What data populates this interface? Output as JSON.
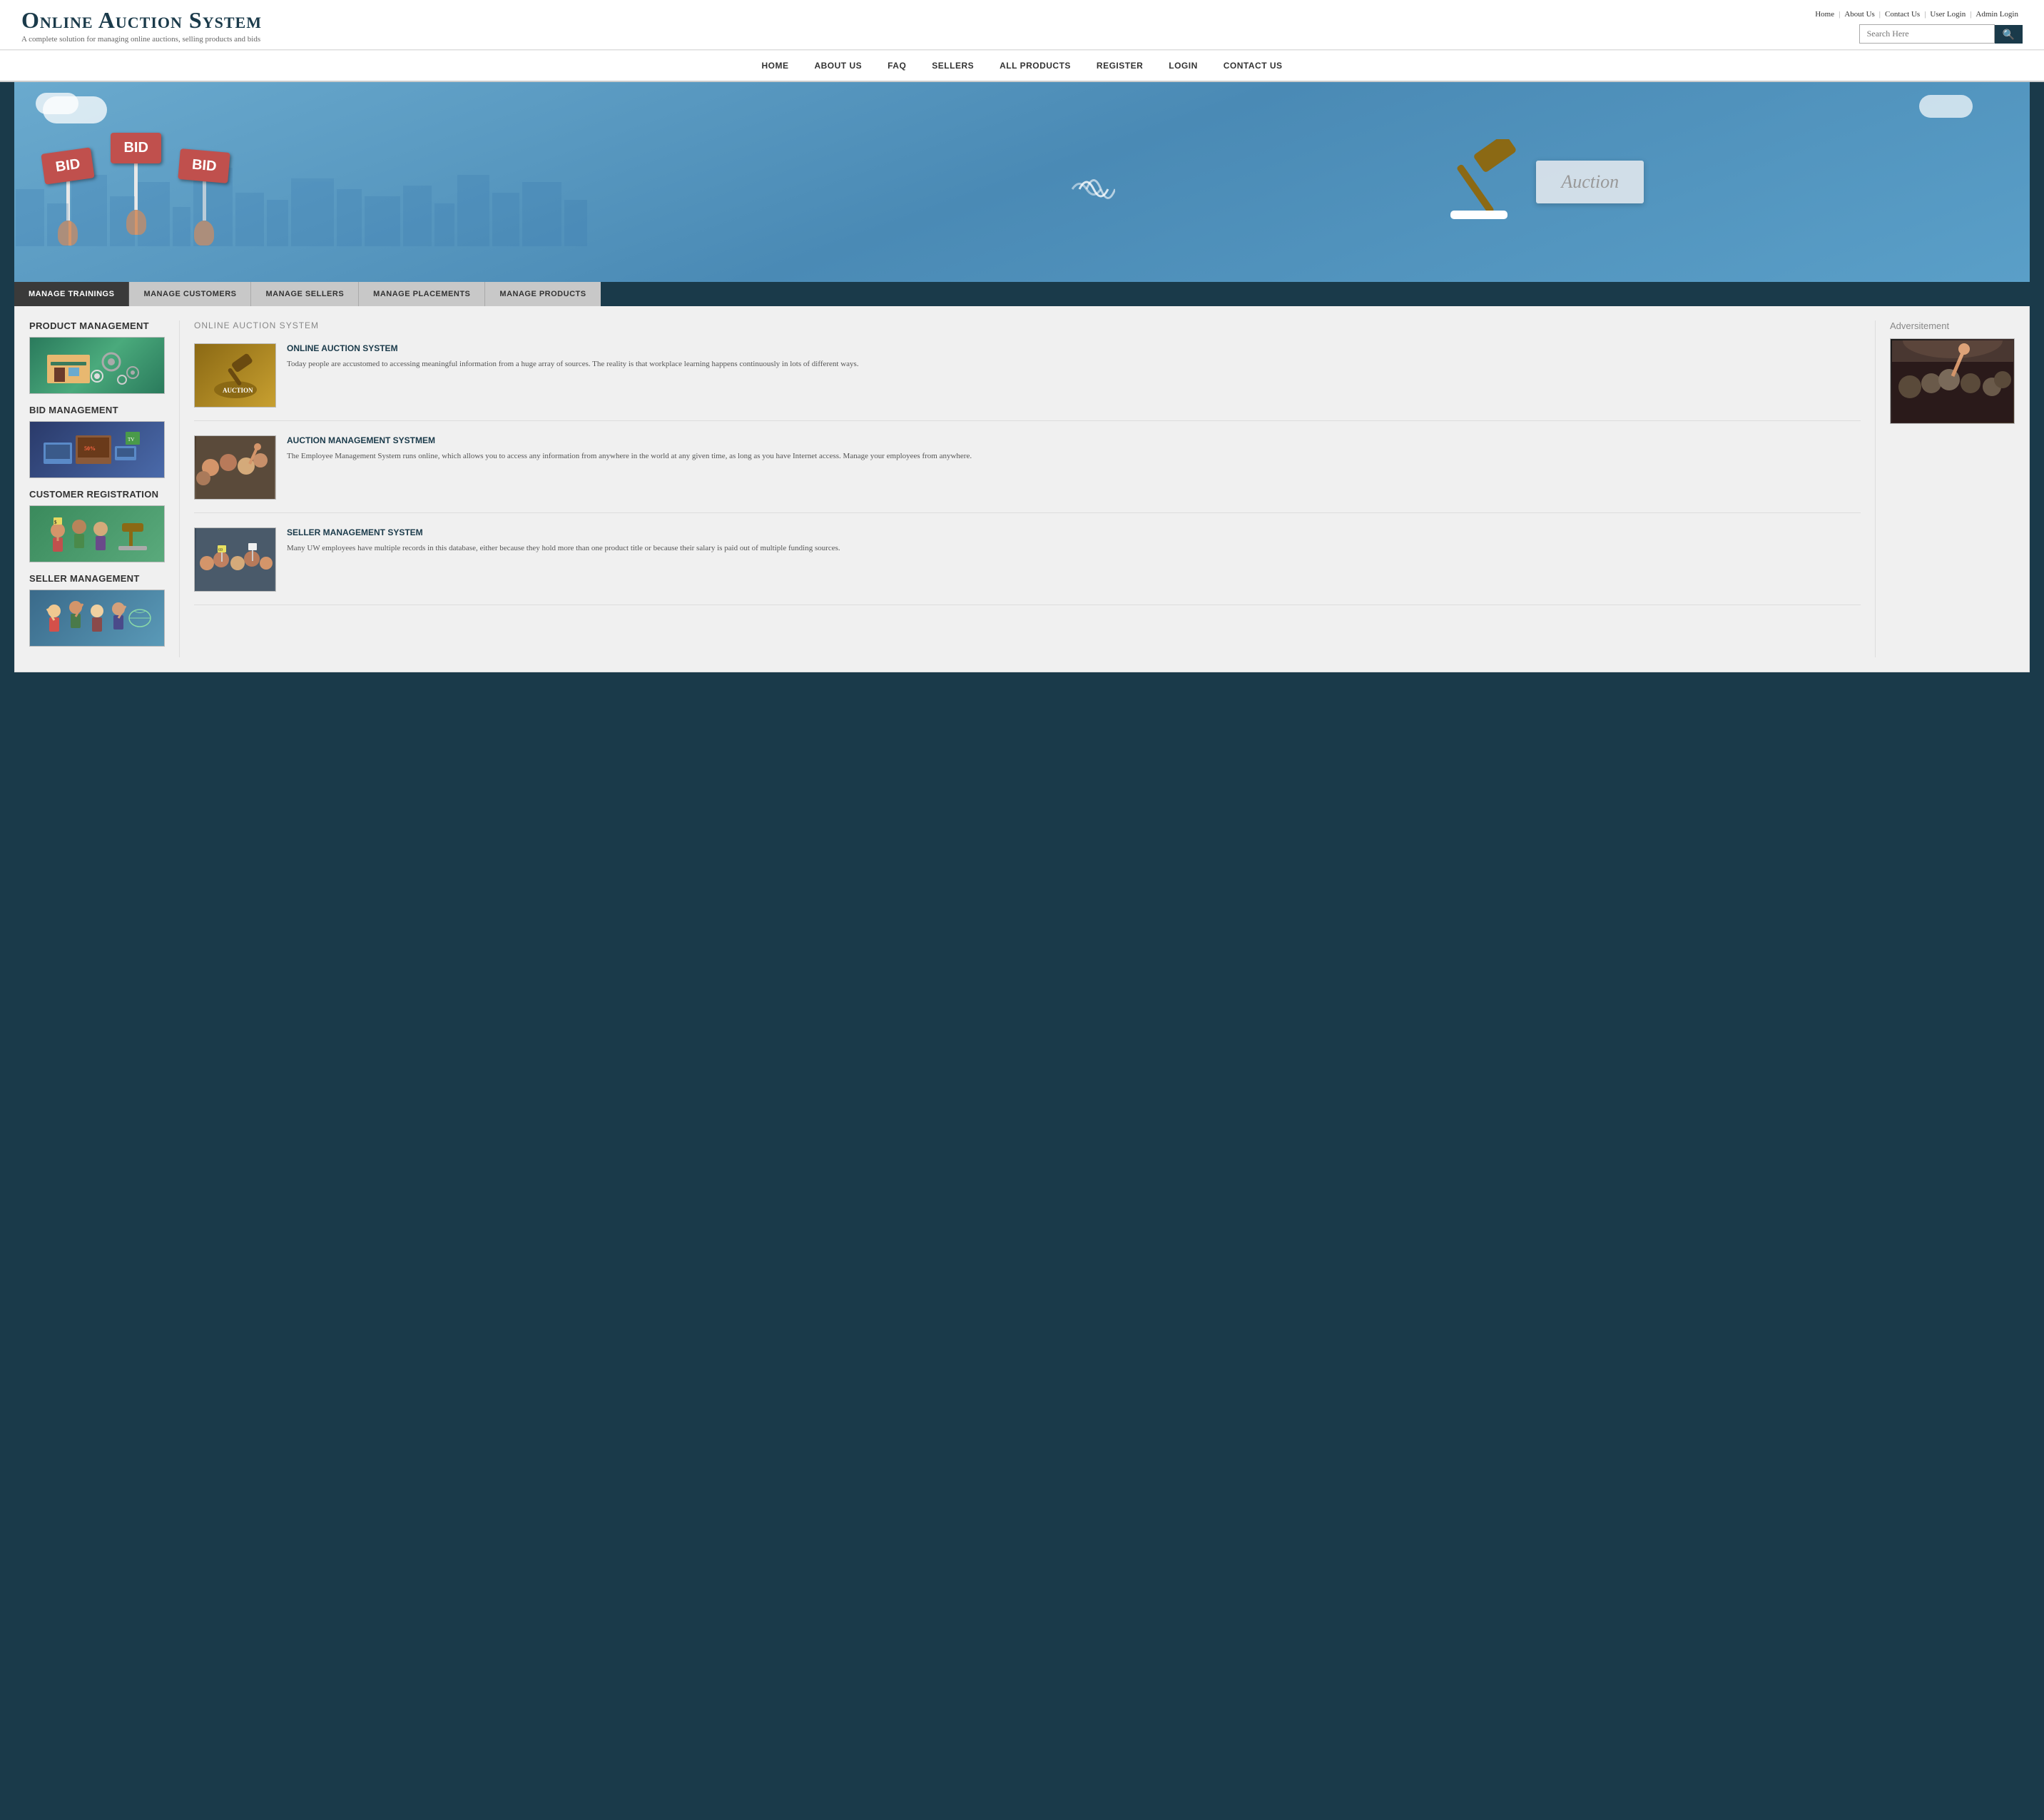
{
  "topLinks": {
    "home": "Home",
    "aboutUs": "About Us",
    "contactUs": "Contact Us",
    "userLogin": "User Login",
    "adminLogin": "Admin Login"
  },
  "logo": {
    "title": "Online Auction System",
    "subtitle": "A complete solution for managing online auctions, selling products and bids"
  },
  "search": {
    "placeholder": "Search Here"
  },
  "nav": {
    "items": [
      {
        "label": "HOME"
      },
      {
        "label": "ABOUT US"
      },
      {
        "label": "FAQ"
      },
      {
        "label": "SELLERS"
      },
      {
        "label": "ALL PRODUCTS"
      },
      {
        "label": "REGISTER"
      },
      {
        "label": "LOGIN"
      },
      {
        "label": "CONTACT US"
      }
    ]
  },
  "hero": {
    "bidText": "BID",
    "auctionText": "Auction"
  },
  "tabs": [
    {
      "label": "MANAGE TRAININGS",
      "active": true
    },
    {
      "label": "MANAGE CUSTOMERS",
      "active": false
    },
    {
      "label": "MANAGE SELLERS",
      "active": false
    },
    {
      "label": "MANAGE PLACEMENTS",
      "active": false
    },
    {
      "label": "MANAGE PRODUCTS",
      "active": false
    }
  ],
  "leftSidebar": {
    "sections": [
      {
        "title": "PRODUCT MANAGEMENT"
      },
      {
        "title": "BID MANAGEMENT"
      },
      {
        "title": "CUSTOMER REGISTRATION"
      },
      {
        "title": "SELLER MANAGEMENT"
      }
    ]
  },
  "centerContent": {
    "sectionHeader": "ONLINE AUCTION SYSTEM",
    "articles": [
      {
        "title": "ONLINE AUCTION SYSTEM",
        "text": "Today people are accustomed to accessing meaningful information from a huge array of sources. The reality is that workplace learning happens continuously in lots of different ways."
      },
      {
        "title": "AUCTION MANAGEMENT SYSTMEM",
        "text": "The Employee Management System runs online, which allows you to access any information from anywhere in the world at any given time, as long as you have Internet access. Manage your employees from anywhere."
      },
      {
        "title": "SELLER MANAGEMENT SYSTEM",
        "text": "Many UW employees have multiple records in this database, either because they hold more than one product title or because their salary is paid out of multiple funding sources."
      }
    ]
  },
  "rightSidebar": {
    "adTitle": "Adversitement"
  }
}
